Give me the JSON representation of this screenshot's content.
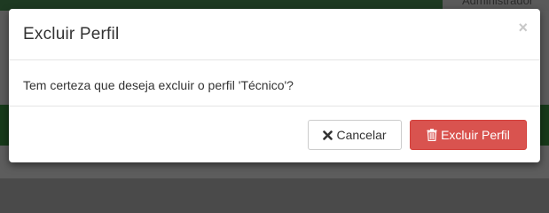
{
  "background": {
    "user_label": "Administrador"
  },
  "modal": {
    "title": "Excluir Perfil",
    "close_symbol": "×",
    "message": "Tem certeza que deseja excluir o perfil 'Técnico'?",
    "buttons": {
      "cancel_label": "Cancelar",
      "cancel_icon": "times-icon",
      "delete_label": "Excluir Perfil",
      "delete_icon": "trash-icon"
    }
  },
  "colors": {
    "danger": "#d9534f",
    "overlay_green": "#173a1a",
    "text": "#333333"
  }
}
